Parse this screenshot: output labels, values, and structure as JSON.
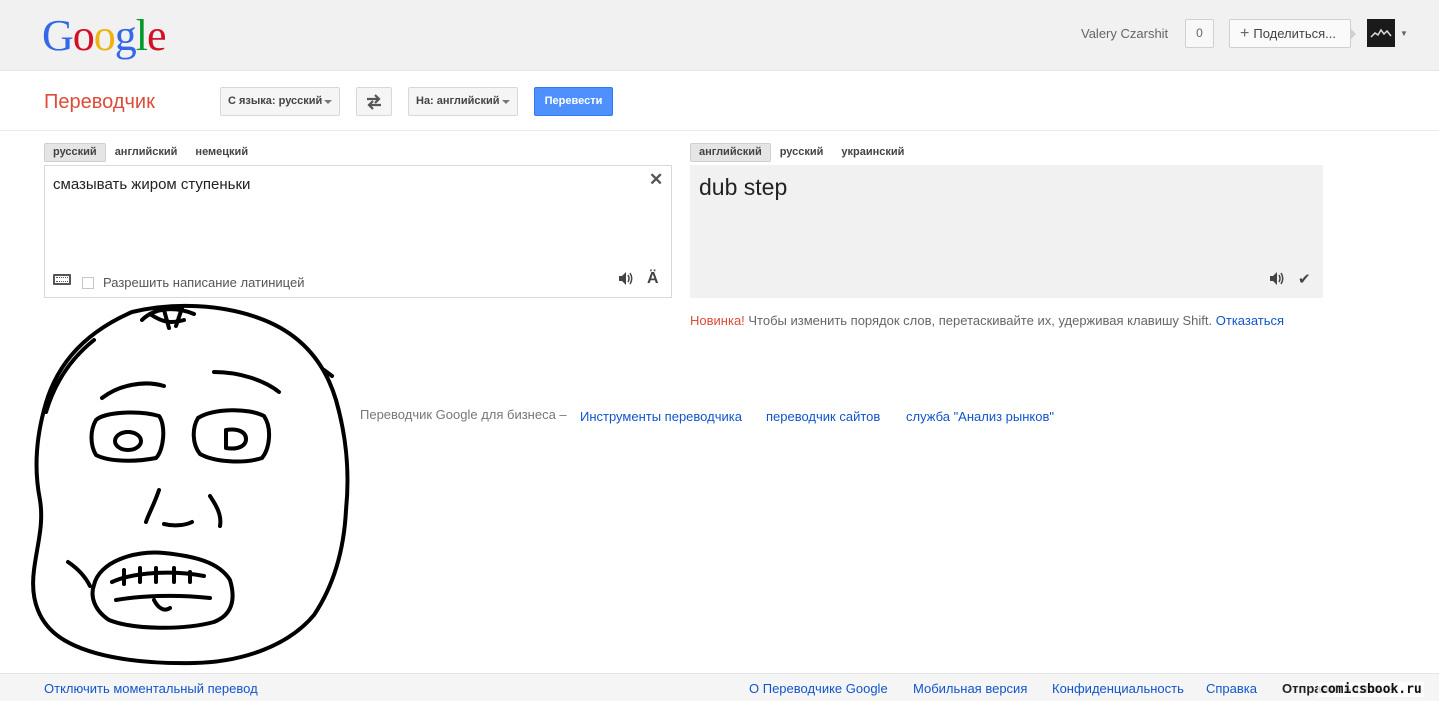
{
  "header": {
    "logo_letters": [
      "G",
      "o",
      "o",
      "g",
      "l",
      "e"
    ],
    "logo_colors": [
      "#3369e8",
      "#d50f25",
      "#eeb211",
      "#3369e8",
      "#009925",
      "#d50f25"
    ],
    "user_name": "Valery Czarshit",
    "notifications_count": "0",
    "share_label": "Поделиться...",
    "share_icon": "plus-icon",
    "avatar_icon": "user-avatar"
  },
  "toolbar": {
    "app_title": "Переводчик",
    "source_select": "С языка: русский",
    "swap_icon": "swap-arrows-icon",
    "target_select": "На: английский",
    "translate_label": "Перевести"
  },
  "source": {
    "lang_tabs": [
      "русский",
      "английский",
      "немецкий"
    ],
    "active_tab": 0,
    "text": "смазывать жиром ступеньки",
    "translit_label": "Разрешить написание латиницей",
    "translit_checked": false
  },
  "target": {
    "lang_tabs": [
      "английский",
      "русский",
      "украинский"
    ],
    "active_tab": 0,
    "text": "dub step"
  },
  "notice": {
    "new_label": "Новинка!",
    "text": " Чтобы изменить порядок слов, перетаскивайте их, удерживая клавишу Shift. ",
    "opt_out": "Отказаться"
  },
  "business": {
    "lead": "Переводчик Google для бизнеса –",
    "links": [
      "Инструменты переводчика",
      "переводчик сайтов",
      "служба \"Анализ рынков\""
    ]
  },
  "footer": {
    "instant_toggle": "Отключить моментальный перевод",
    "links": [
      "О Переводчике Google",
      "Мобильная версия",
      "Конфиденциальность",
      "Справка"
    ],
    "feedback": "Отправить отзыв"
  },
  "watermark": "comicsbook.ru",
  "colors": {
    "accent_red": "#dd4b39",
    "link_blue": "#1155cc",
    "button_blue": "#4d90fe"
  }
}
